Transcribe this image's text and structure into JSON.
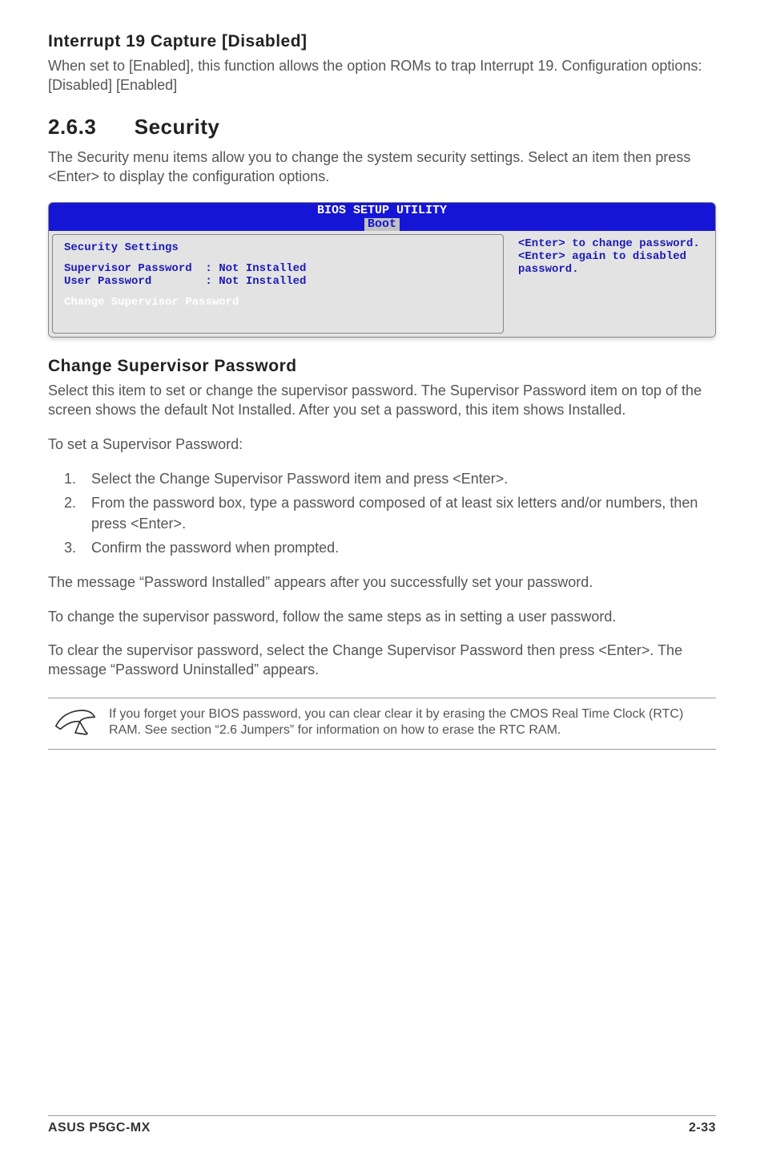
{
  "s1": {
    "heading": "Interrupt 19 Capture [Disabled]",
    "body": "When set to [Enabled], this function allows the option ROMs to trap Interrupt 19. Configuration options: [Disabled] [Enabled]"
  },
  "s2": {
    "num": "2.6.3",
    "title": "Security",
    "body": "The Security menu items allow you to change the system security settings. Select an item then press <Enter> to display the configuration options."
  },
  "bios": {
    "title": "BIOS SETUP UTILITY",
    "tab": "Boot",
    "left_header": "Security Settings",
    "row1": "Supervisor Password  : Not Installed",
    "row2": "User Password        : Not Installed",
    "selected": "Change Supervisor Password",
    "help": "<Enter> to change password.\n<Enter> again to disabled password."
  },
  "s3": {
    "heading": "Change Supervisor Password",
    "p1": "Select this item to set or change the supervisor password. The Supervisor Password item on top of the screen shows the default Not Installed. After you set a password, this item shows Installed.",
    "p2": "To set a Supervisor Password:",
    "steps": [
      "Select the Change Supervisor Password item and press <Enter>.",
      "From the password box, type a password composed of at least six letters and/or numbers, then press <Enter>.",
      "Confirm the password when prompted."
    ],
    "p3": "The message “Password Installed” appears after you successfully set your password.",
    "p4": "To change the supervisor password, follow the same steps as in setting a user password.",
    "p5": "To clear the supervisor password, select the Change Supervisor Password then press <Enter>. The message “Password Uninstalled” appears."
  },
  "note": {
    "text": "If you forget your BIOS password, you can clear clear it by erasing the CMOS Real Time Clock (RTC) RAM. See section “2.6  Jumpers” for information on how to erase the RTC RAM."
  },
  "footer": {
    "left": "ASUS P5GC-MX",
    "right": "2-33"
  }
}
